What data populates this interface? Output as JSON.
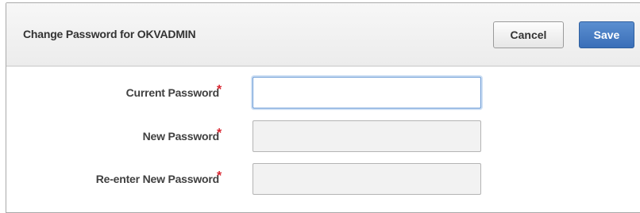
{
  "dialog": {
    "title": "Change Password for OKVADMIN",
    "cancel_label": "Cancel",
    "save_label": "Save"
  },
  "form": {
    "required_marker": "*",
    "current_password": {
      "label": "Current Password",
      "value": ""
    },
    "new_password": {
      "label": "New Password",
      "value": ""
    },
    "reenter_password": {
      "label": "Re-enter New Password",
      "value": ""
    }
  }
}
